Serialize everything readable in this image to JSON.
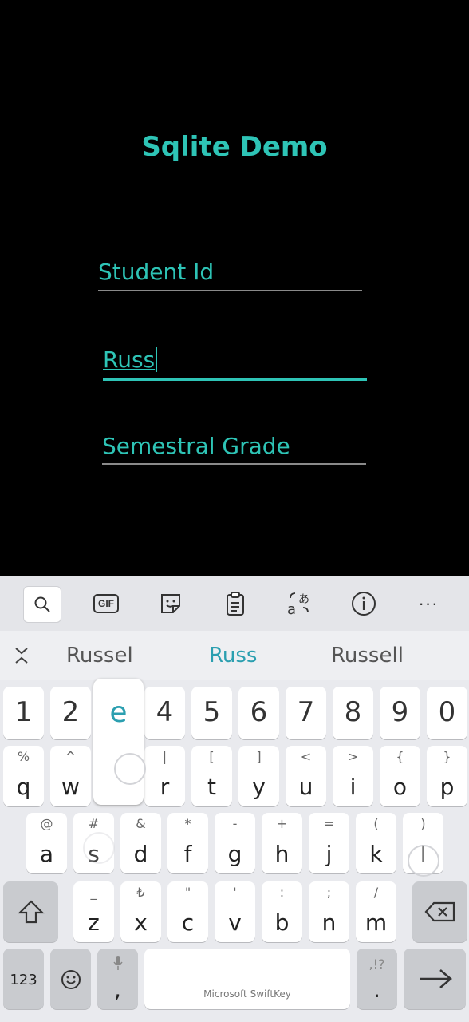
{
  "app": {
    "title": "Sqlite Demo",
    "fields": {
      "student_id_placeholder": "Student Id",
      "name_value": "Russ",
      "grade_placeholder": "Semestral Grade"
    }
  },
  "keyboard": {
    "toolbar": [
      "search-icon",
      "gif-icon",
      "sticker-icon",
      "clipboard-icon",
      "translate-icon",
      "info-icon",
      "more-icon"
    ],
    "toolbar_labels": {
      "gif": "GIF",
      "more": "···",
      "info": "i"
    },
    "suggestions": [
      "Russel",
      "Russ",
      "Russell"
    ],
    "popup_key": "e",
    "brand": "Microsoft SwiftKey",
    "row_numbers": [
      "1",
      "2",
      "3",
      "4",
      "5",
      "6",
      "7",
      "8",
      "9",
      "0"
    ],
    "row1": [
      {
        "main": "q",
        "sub": "%"
      },
      {
        "main": "w",
        "sub": "^"
      },
      {
        "main": "e",
        "sub": "~"
      },
      {
        "main": "r",
        "sub": "|"
      },
      {
        "main": "t",
        "sub": "["
      },
      {
        "main": "y",
        "sub": "]"
      },
      {
        "main": "u",
        "sub": "<"
      },
      {
        "main": "i",
        "sub": ">"
      },
      {
        "main": "o",
        "sub": "{"
      },
      {
        "main": "p",
        "sub": "}"
      }
    ],
    "row2": [
      {
        "main": "a",
        "sub": "@"
      },
      {
        "main": "s",
        "sub": "#"
      },
      {
        "main": "d",
        "sub": "&"
      },
      {
        "main": "f",
        "sub": "*"
      },
      {
        "main": "g",
        "sub": "-"
      },
      {
        "main": "h",
        "sub": "+"
      },
      {
        "main": "j",
        "sub": "="
      },
      {
        "main": "k",
        "sub": "("
      },
      {
        "main": "l",
        "sub": ")"
      }
    ],
    "row3": [
      {
        "main": "z",
        "sub": "_"
      },
      {
        "main": "x",
        "sub": "₺"
      },
      {
        "main": "c",
        "sub": "\""
      },
      {
        "main": "v",
        "sub": "'"
      },
      {
        "main": "b",
        "sub": ":"
      },
      {
        "main": "n",
        "sub": ";"
      },
      {
        "main": "m",
        "sub": "/"
      }
    ],
    "bottom": {
      "num_label": "123",
      "comma": ",",
      "period": ".",
      "period_sub": ",!?"
    }
  },
  "colors": {
    "accent": "#2ec4b6",
    "suggest_accent": "#2b9fb0",
    "background": "#000000",
    "keyboard_bg": "#e9eaee"
  }
}
